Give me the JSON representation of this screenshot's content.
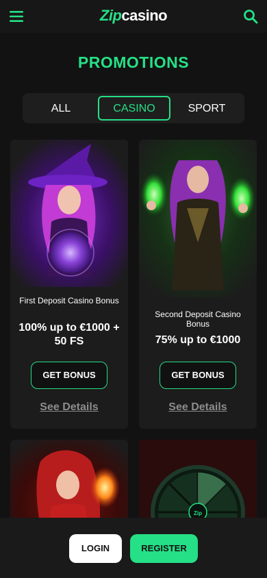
{
  "header": {
    "logo_zip": "Zip",
    "logo_rest": "casino",
    "menu_icon": "hamburger-icon",
    "search_icon": "search-icon"
  },
  "page_title": "PROMOTIONS",
  "tabs": [
    {
      "label": "ALL",
      "active": false
    },
    {
      "label": "CASINO",
      "active": true
    },
    {
      "label": "SPORT",
      "active": false
    }
  ],
  "promos": [
    {
      "subtitle": "First Deposit Casino Bonus",
      "amount": "100% up to €1000 + 50 FS",
      "button": "GET BONUS",
      "details": "See Details"
    },
    {
      "subtitle": "Second Deposit Casino Bonus",
      "amount": "75% up to €1000",
      "button": "GET BONUS",
      "details": "See Details"
    }
  ],
  "wheel_label": "Zip",
  "footer": {
    "login": "LOGIN",
    "register": "REGISTER"
  },
  "colors": {
    "accent": "#25e086",
    "background": "#121212",
    "card": "#1c1c1c"
  }
}
